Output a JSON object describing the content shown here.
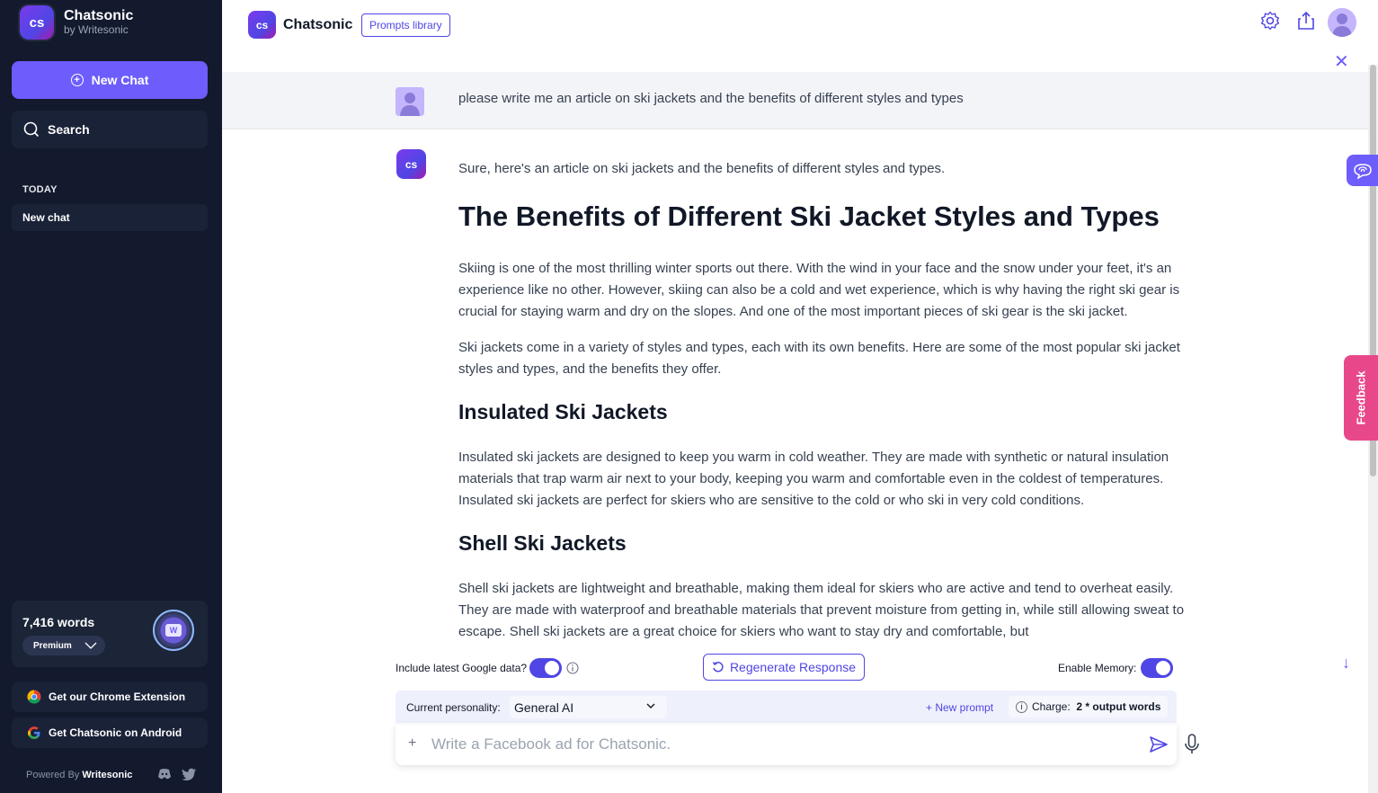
{
  "sidebar": {
    "brand_name": "Chatsonic",
    "brand_by": "by Writesonic",
    "logo_text": "cs",
    "new_chat_label": "New Chat",
    "search_label": "Search",
    "section_today": "TODAY",
    "chats": [
      "New chat"
    ],
    "words_count": "7,416 words",
    "plan": "Premium",
    "words_badge": "W",
    "chrome_ext": "Get our Chrome Extension",
    "android": "Get Chatsonic on Android",
    "powered_prefix": "Powered By ",
    "powered_brand": "Writesonic"
  },
  "header": {
    "title": "Chatsonic",
    "logo_text": "cs",
    "prompts_library": "Prompts library"
  },
  "conversation": {
    "user_message": "please write me an article on ski jackets and the benefits of different styles and types",
    "bot_logo_text": "cs",
    "intro": "Sure, here's an article on ski jackets and the benefits of different styles and types.",
    "title": "The Benefits of Different Ski Jacket Styles and Types",
    "p1": "Skiing is one of the most thrilling winter sports out there. With the wind in your face and the snow under your feet, it's an experience like no other. However, skiing can also be a cold and wet experience, which is why having the right ski gear is crucial for staying warm and dry on the slopes. And one of the most important pieces of ski gear is the ski jacket.",
    "p2": "Ski jackets come in a variety of styles and types, each with its own benefits. Here are some of the most popular ski jacket styles and types, and the benefits they offer.",
    "h2_insulated": "Insulated Ski Jackets",
    "p3": "Insulated ski jackets are designed to keep you warm in cold weather. They are made with synthetic or natural insulation materials that trap warm air next to your body, keeping you warm and comfortable even in the coldest of temperatures. Insulated ski jackets are perfect for skiers who are sensitive to the cold or who ski in very cold conditions.",
    "h2_shell": "Shell Ski Jackets",
    "p4": "Shell ski jackets are lightweight and breathable, making them ideal for skiers who are active and tend to overheat easily. They are made with waterproof and breathable materials that prevent moisture from getting in, while still allowing sweat to escape. Shell ski jackets are a great choice for skiers who want to stay dry and comfortable, but"
  },
  "controls": {
    "google_label": "Include latest Google data?",
    "google_on": true,
    "memory_label": "Enable Memory:",
    "memory_on": true,
    "regenerate": "Regenerate Response",
    "personality_label": "Current personality:",
    "personality_value": "General AI",
    "new_prompt": "+ New prompt",
    "charge_label": "Charge:",
    "charge_value": "2 * output words",
    "input_placeholder": "Write a Facebook ad for Chatsonic.",
    "feedback": "Feedback"
  },
  "colors": {
    "accent": "#6d5dfc",
    "sidebar_bg": "#131a2e",
    "feedback": "#e8488a"
  }
}
